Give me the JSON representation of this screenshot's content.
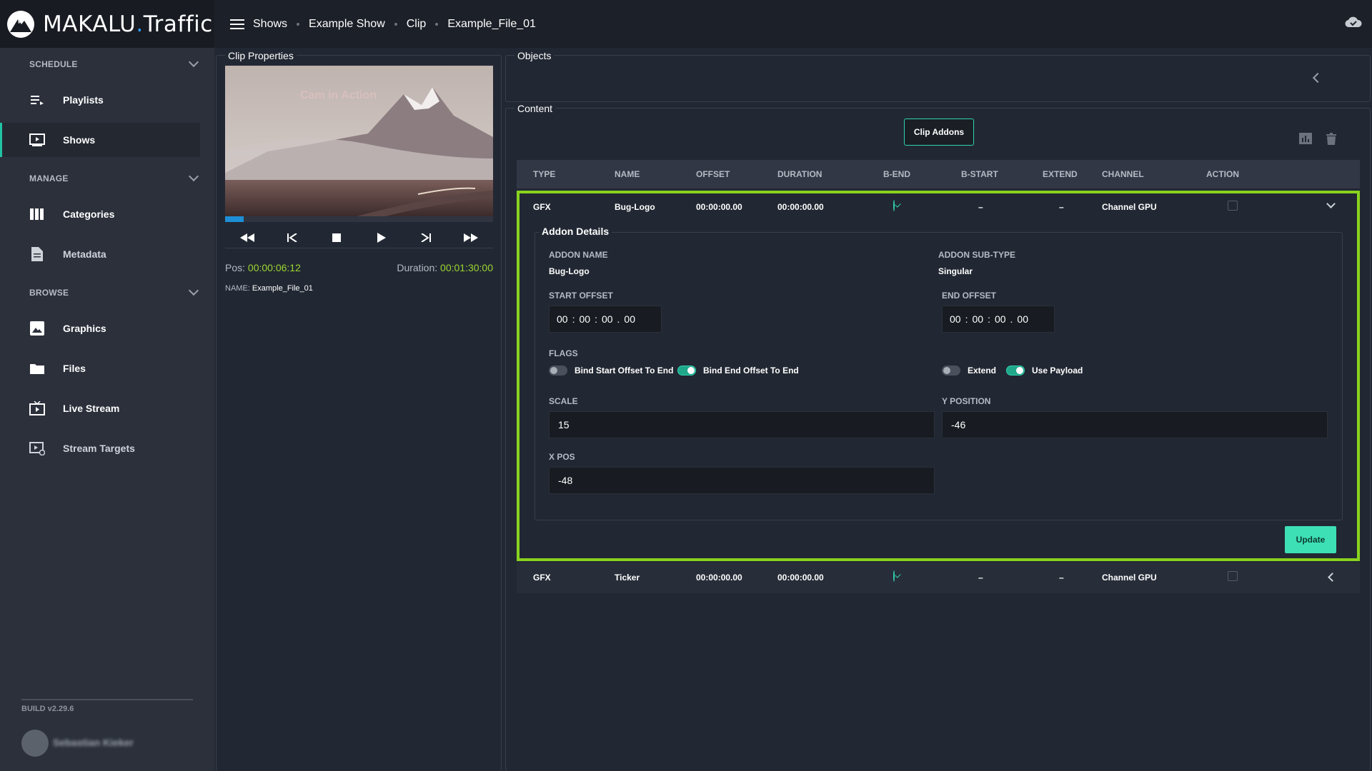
{
  "app": {
    "brand": "MAKALU",
    "brand_dot": ".",
    "brand_suffix": "Traffic"
  },
  "breadcrumb": [
    "Shows",
    "Example Show",
    "Clip",
    "Example_File_01"
  ],
  "sidebar": {
    "sections": [
      {
        "label": "SCHEDULE",
        "items": [
          {
            "label": "Playlists",
            "icon": "playlist-icon"
          },
          {
            "label": "Shows",
            "icon": "shows-icon",
            "active": true
          }
        ]
      },
      {
        "label": "MANAGE",
        "items": [
          {
            "label": "Categories",
            "icon": "categories-icon"
          },
          {
            "label": "Metadata",
            "icon": "document-icon"
          }
        ]
      },
      {
        "label": "BROWSE",
        "items": [
          {
            "label": "Graphics",
            "icon": "image-icon"
          },
          {
            "label": "Files",
            "icon": "folder-icon"
          },
          {
            "label": "Live Stream",
            "icon": "live-stream-icon"
          },
          {
            "label": "Stream Targets",
            "icon": "stream-targets-icon"
          }
        ]
      }
    ],
    "build": "BUILD v2.29.6",
    "user": "Sebastian Kieker"
  },
  "clip_properties": {
    "title": "Clip Properties",
    "video_caption": "Cam in Action",
    "progress_pct": 7,
    "pos_label": "Pos:",
    "pos_value": "00:00:06:12",
    "duration_label": "Duration:",
    "duration_value": "00:01:30:00",
    "name_label": "NAME:",
    "name_value": "Example_File_01"
  },
  "objects": {
    "title": "Objects"
  },
  "content": {
    "title": "Content",
    "clip_addons_label": "Clip Addons",
    "columns": [
      "TYPE",
      "NAME",
      "OFFSET",
      "DURATION",
      "B-END",
      "B-START",
      "EXTEND",
      "CHANNEL",
      "ACTION"
    ],
    "rows": [
      {
        "type": "GFX",
        "name": "Bug-Logo",
        "offset": "00:00:00.00",
        "duration": "00:00:00.00",
        "b_start": "–",
        "extend": "–",
        "channel": "Channel GPU"
      },
      {
        "type": "GFX",
        "name": "Ticker",
        "offset": "00:00:00.00",
        "duration": "00:00:00.00",
        "b_start": "–",
        "extend": "–",
        "channel": "Channel GPU"
      }
    ],
    "addon_details": {
      "title": "Addon Details",
      "addon_name_label": "ADDON NAME",
      "addon_name": "Bug-Logo",
      "addon_subtype_label": "ADDON SUB-TYPE",
      "addon_subtype": "Singular",
      "start_offset_label": "START OFFSET",
      "start_offset": [
        "00",
        "00",
        "00",
        "00"
      ],
      "end_offset_label": "END OFFSET",
      "end_offset": [
        "00",
        "00",
        "00",
        "00"
      ],
      "flags_label": "FLAGS",
      "flags": [
        {
          "label": "Bind Start Offset To End",
          "on": false
        },
        {
          "label": "Bind End Offset To End",
          "on": true
        },
        {
          "label": "Extend",
          "on": false
        },
        {
          "label": "Use Payload",
          "on": true
        }
      ],
      "scale_label": "SCALE",
      "scale": "15",
      "ypos_label": "Y POSITION",
      "ypos": "-46",
      "xpos_label": "X POS",
      "xpos": "-48",
      "update_label": "Update"
    }
  }
}
